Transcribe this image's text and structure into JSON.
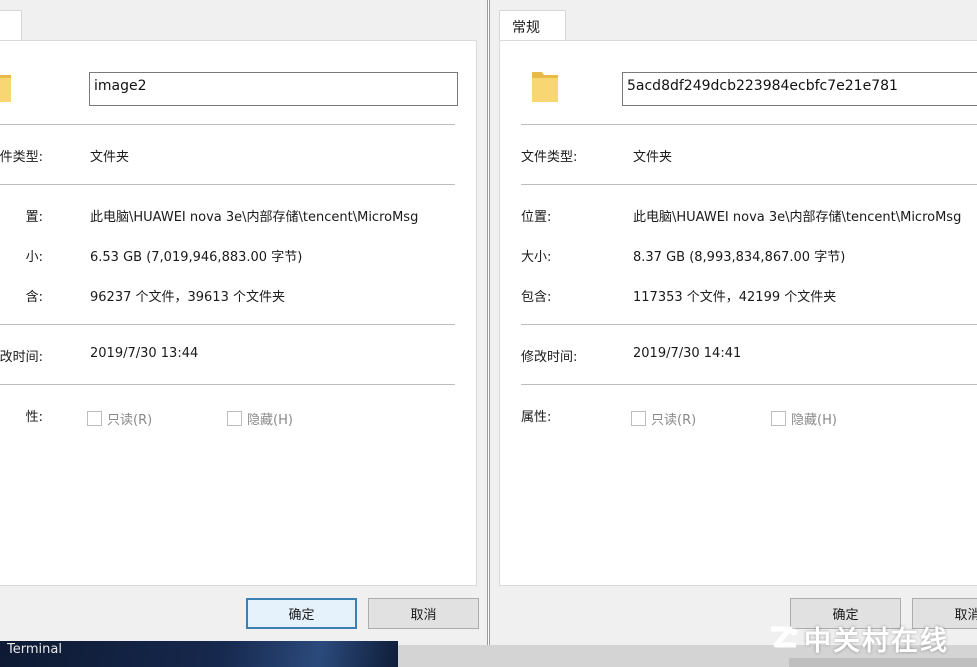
{
  "left_dialog": {
    "folder_name": "image2",
    "rows": [
      {
        "label": "件类型:",
        "value": "文件夹"
      },
      {
        "label": "置:",
        "value": "此电脑\\HUAWEI nova 3e\\内部存储\\tencent\\MicroMsg"
      },
      {
        "label": "小:",
        "value": "6.53 GB (7,019,946,883.00 字节)"
      },
      {
        "label": "含:",
        "value": " 96237 个文件，39613 个文件夹"
      },
      {
        "label": "改时间:",
        "value": "2019/7/30 13:44"
      },
      {
        "label": "性:",
        "value": ""
      }
    ],
    "readonly_label": "只读(R)",
    "hidden_label": "隐藏(H)",
    "ok_label": "确定",
    "cancel_label": "取消"
  },
  "right_dialog": {
    "tab_label": "常规",
    "folder_name": "5acd8df249dcb223984ecbfc7e21e781",
    "rows": [
      {
        "label": "文件类型:",
        "value": "文件夹"
      },
      {
        "label": "位置:",
        "value": "此电脑\\HUAWEI nova 3e\\内部存储\\tencent\\MicroMsg"
      },
      {
        "label": "大小:",
        "value": "8.37 GB (8,993,834,867.00 字节)"
      },
      {
        "label": "包含:",
        "value": " 117353 个文件，42199 个文件夹"
      },
      {
        "label": "修改时间:",
        "value": "2019/7/30 14:41"
      },
      {
        "label": "属性:",
        "value": ""
      }
    ],
    "readonly_label": "只读(R)",
    "hidden_label": "隐藏(H)",
    "ok_label": "确定",
    "cancel_label": "取消"
  },
  "taskbar": {
    "terminal_label": "Terminal"
  },
  "watermark": {
    "text": "中关村在线"
  },
  "colors": {
    "dialog_bg": "#f0f0f0",
    "panel_bg": "#ffffff",
    "folder_yellow": "#f5d06b",
    "primary_border": "#3c7fb1",
    "disabled_text": "#8a8a8a"
  }
}
